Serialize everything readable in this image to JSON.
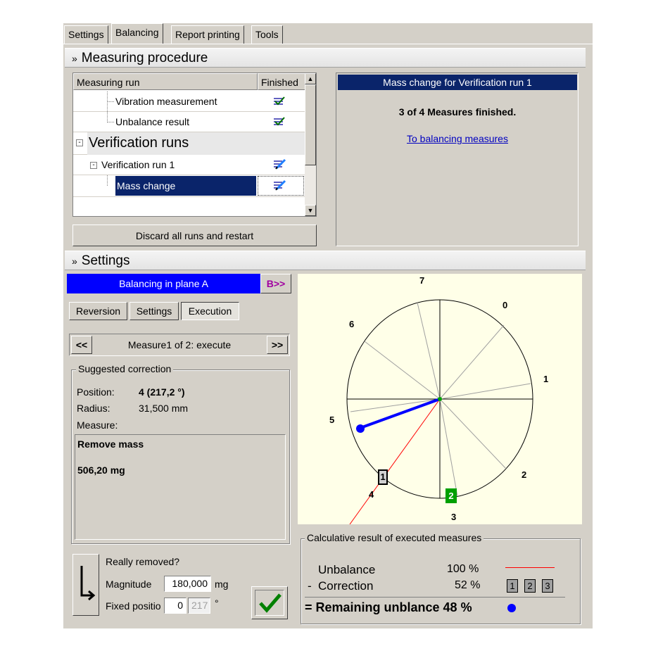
{
  "tabs": [
    "Settings",
    "Balancing",
    "Report printing",
    "Tools"
  ],
  "measuring": {
    "title": "Measuring procedure",
    "columns": {
      "run": "Measuring run",
      "finished": "Finished"
    },
    "rows": [
      {
        "label": "Vibration measurement"
      },
      {
        "label": "Unbalance result"
      },
      {
        "label": "Verification runs"
      },
      {
        "label": "Verification run 1"
      },
      {
        "label": "Mass change"
      }
    ],
    "discard_label": "Discard all runs and restart"
  },
  "info_panel": {
    "title": "Mass change for Verification run 1",
    "status": "3 of 4 Measures finished.",
    "link": "To balancing measures"
  },
  "settings": {
    "title": "Settings",
    "plane_label": "Balancing in plane A",
    "plane_b_btn": "B>>",
    "subtabs": [
      "Reversion",
      "Settings",
      "Execution"
    ],
    "nav_prev": "<<",
    "nav_label": "Measure1 of 2: execute",
    "nav_next": ">>",
    "suggested": {
      "legend": "Suggested correction",
      "position_label": "Position:",
      "position_value": "4 (217,2 °)",
      "radius_label": "Radius:",
      "radius_value": "31,500 mm",
      "measure_label": "Measure:",
      "action": "Remove mass",
      "amount": "506,20 mg"
    },
    "confirm": {
      "question": "Really removed?",
      "magnitude_label": "Magnitude",
      "magnitude_value": "180,000",
      "magnitude_unit": "mg",
      "fixed_label": "Fixed positio",
      "fixed_value": "0",
      "fixed_angle": "217",
      "fixed_unit": "°"
    }
  },
  "polar": {
    "numbers": [
      "0",
      "1",
      "2",
      "3",
      "4",
      "5",
      "6",
      "7"
    ],
    "marker1": "1",
    "marker2": "2",
    "colors": {
      "bg": "#ffffe8",
      "vector": "#0000ff",
      "line": "#ff0000",
      "marker2": "#00a000"
    }
  },
  "result": {
    "legend": "Calculative result of executed measures",
    "unbalance_label": "Unbalance",
    "unbalance_value": "100 %",
    "correction_prefix": "-",
    "correction_label": "Correction",
    "correction_value": "52 %",
    "boxes": [
      "1",
      "2",
      "3"
    ],
    "remaining": "= Remaining unblance 48 %"
  }
}
